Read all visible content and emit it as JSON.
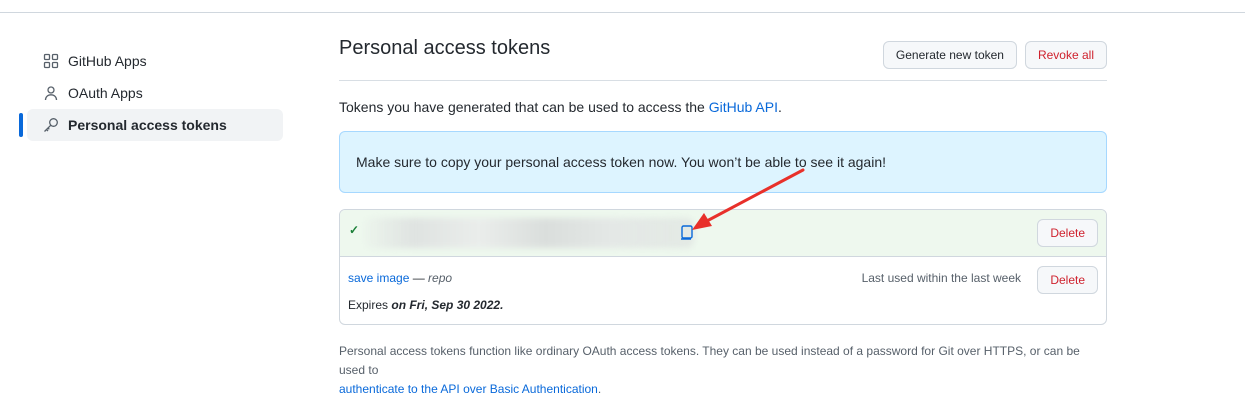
{
  "sidebar": {
    "items": [
      {
        "label": "GitHub Apps",
        "icon": "apps-icon"
      },
      {
        "label": "OAuth Apps",
        "icon": "person-icon"
      },
      {
        "label": "Personal access tokens",
        "icon": "key-icon",
        "active": true
      }
    ]
  },
  "main": {
    "title": "Personal access tokens",
    "generate_label": "Generate new token",
    "revoke_label": "Revoke all",
    "intro_text": "Tokens you have generated that can be used to access the ",
    "intro_link": "GitHub API",
    "intro_end": ".",
    "flash": "Make sure to copy your personal access token now. You won’t be able to see it again!",
    "new_token": {
      "check": "✓",
      "delete_label": "Delete"
    },
    "token": {
      "name": "save image",
      "dash": " — ",
      "scope": "repo",
      "last_used": "Last used within the last week",
      "expires_prefix": "Expires ",
      "expires_date": "on Fri, Sep 30 2022.",
      "delete_label": "Delete"
    },
    "footer_text": "Personal access tokens function like ordinary OAuth access tokens. They can be used instead of a password for Git over HTTPS, or can be used to",
    "footer_link": "authenticate to the API over Basic Authentication",
    "footer_end": "."
  },
  "colors": {
    "accent": "#0969da",
    "danger": "#cf222e",
    "success": "#1a7f37",
    "annotation_arrow": "#e8302a"
  }
}
